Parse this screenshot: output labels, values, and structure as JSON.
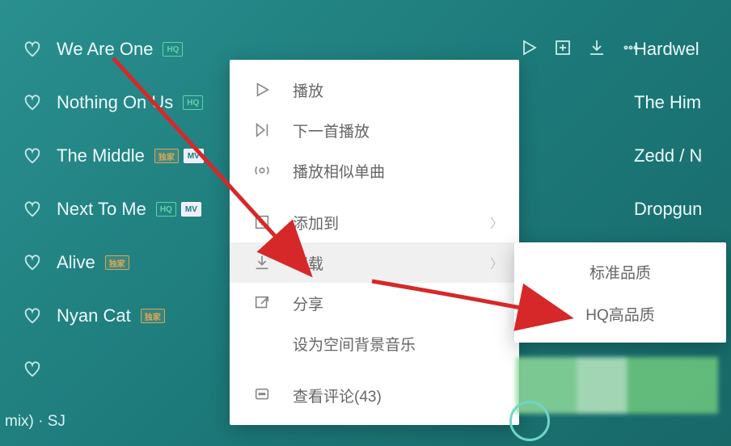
{
  "songs": [
    {
      "title": "We Are One",
      "artist": "Hardwel",
      "badges": [
        "hq"
      ],
      "show_actions": true
    },
    {
      "title": "Nothing On Us",
      "artist": "The Him",
      "badges": [
        "hq"
      ]
    },
    {
      "title": "The Middle",
      "artist": "Zedd / N",
      "badges": [
        "vip",
        "mv"
      ]
    },
    {
      "title": "Next To Me",
      "artist": "Dropgun",
      "badges": [
        "hq",
        "mv"
      ]
    },
    {
      "title": "Alive",
      "artist": "",
      "badges": [
        "vip"
      ]
    },
    {
      "title": "Nyan Cat",
      "artist": "",
      "badges": [
        "vip"
      ]
    },
    {
      "title": "",
      "artist": "",
      "badges": []
    }
  ],
  "badge_text": {
    "hq": "HQ",
    "vip": "独家",
    "mv": "MV"
  },
  "menu": {
    "play": "播放",
    "play_next": "下一首播放",
    "similar": "播放相似单曲",
    "add_to": "添加到",
    "download": "下载",
    "share": "分享",
    "set_bgm": "设为空间背景音乐",
    "comments": "查看评论(43)"
  },
  "submenu": {
    "standard": "标准品质",
    "hq": "HQ高品质"
  },
  "bottom": {
    "now_playing": "mix) · SJ"
  }
}
